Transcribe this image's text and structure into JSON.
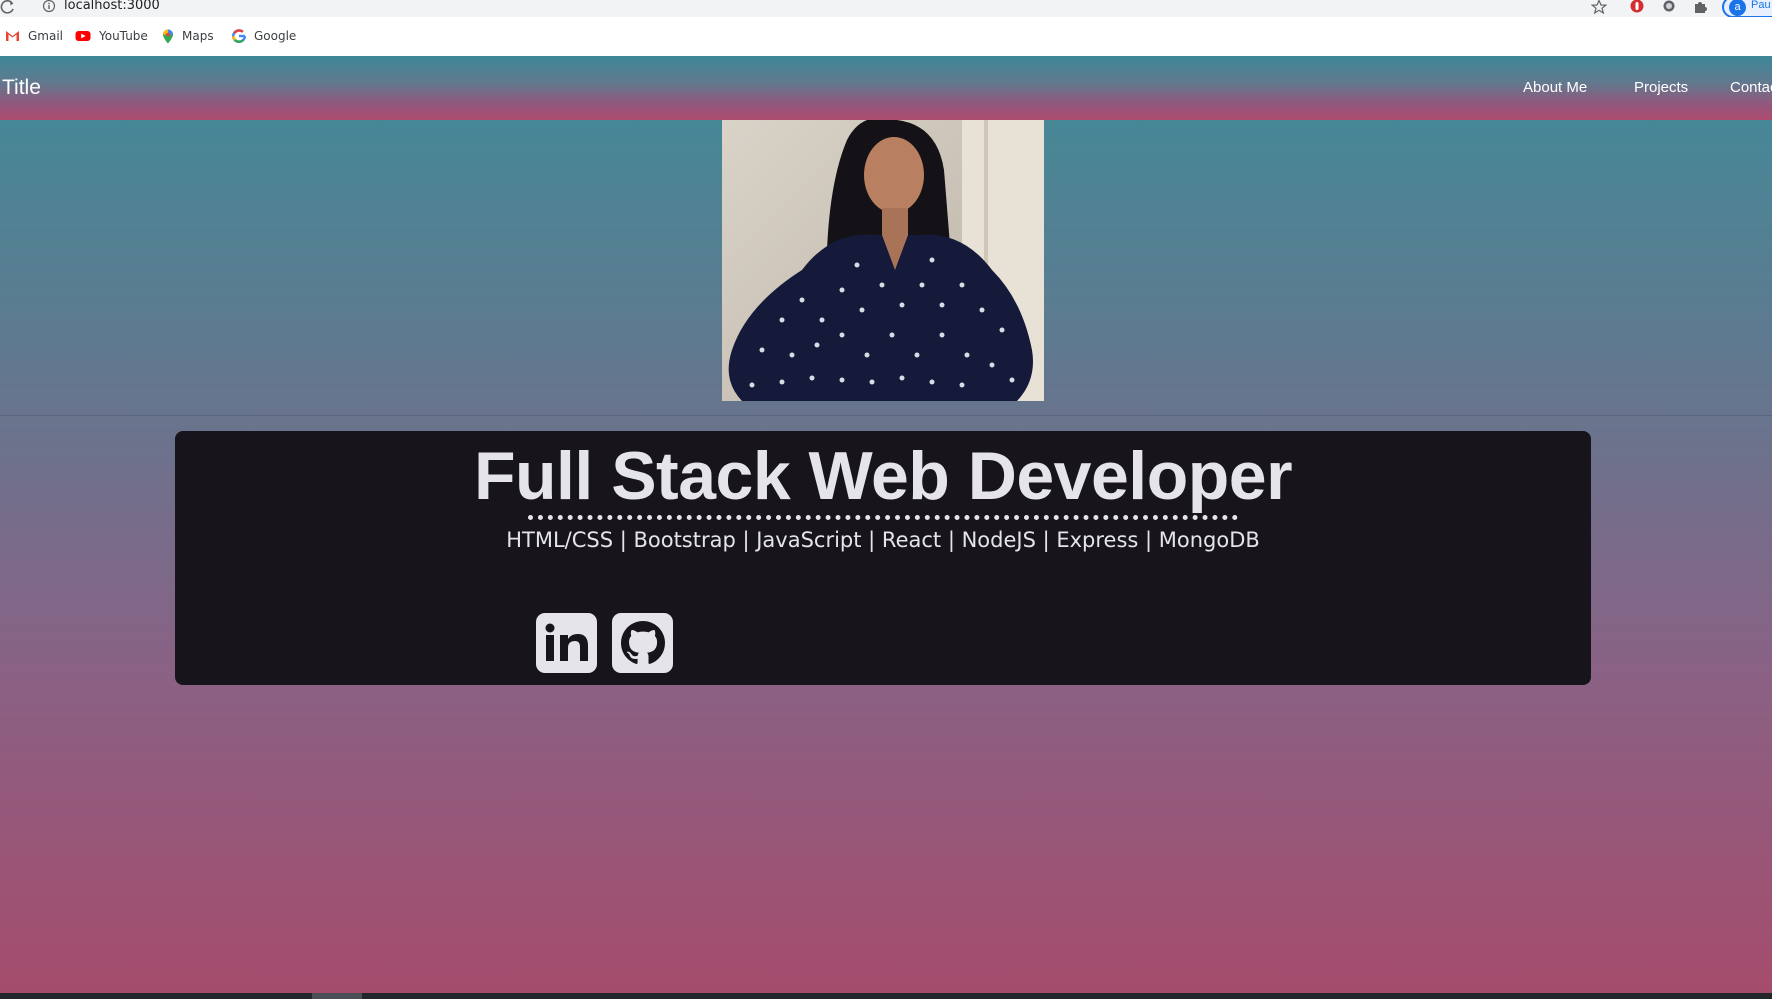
{
  "browser": {
    "url": "localhost:3000",
    "profile_initial": "a",
    "profile_name": "Pau",
    "bookmarks": [
      {
        "label": "Gmail",
        "icon": "gmail-icon"
      },
      {
        "label": "YouTube",
        "icon": "youtube-icon"
      },
      {
        "label": "Maps",
        "icon": "maps-icon"
      },
      {
        "label": "Google",
        "icon": "google-icon"
      }
    ]
  },
  "navbar": {
    "brand": "Title",
    "links": [
      "About Me",
      "Projects",
      "Contac"
    ]
  },
  "hero": {
    "title": "Full Stack Web Developer",
    "skills": "HTML/CSS | Bootstrap | JavaScript | React | NodeJS | Express | MongoDB",
    "social": [
      {
        "name": "linkedin",
        "icon": "linkedin-icon"
      },
      {
        "name": "github",
        "icon": "github-icon"
      }
    ]
  },
  "colors": {
    "card_bg": "#17151b",
    "text_light": "#e4e4ea",
    "gradient_top": "#3f8b98",
    "gradient_bottom": "#a54c6c"
  }
}
